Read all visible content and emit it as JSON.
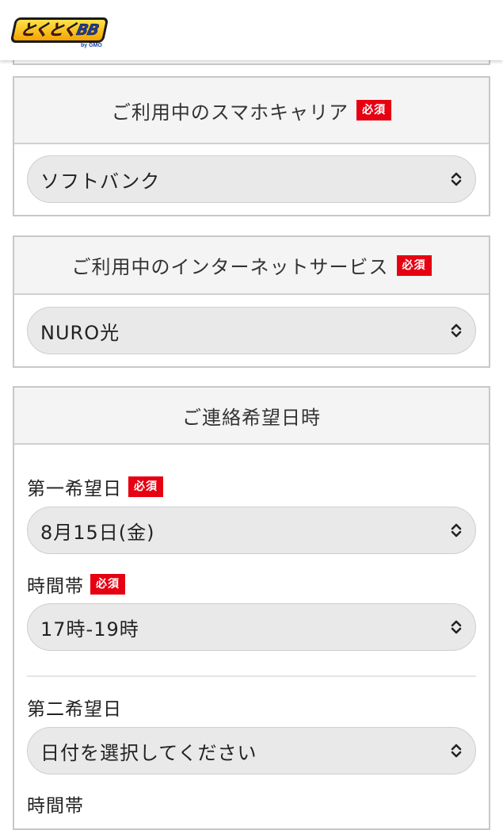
{
  "header": {
    "logo_main_1": "とくとく",
    "logo_main_2": "BB",
    "logo_sub": "by GMO"
  },
  "required_badge": "必須",
  "carrier": {
    "title": "ご利用中のスマホキャリア",
    "selected": "ソフトバンク"
  },
  "internet": {
    "title": "ご利用中のインターネットサービス",
    "selected": "NURO光"
  },
  "contact": {
    "title": "ご連絡希望日時",
    "first_date_label": "第一希望日",
    "first_date_value": "8月15日(金)",
    "first_time_label": "時間帯",
    "first_time_value": "17時-19時",
    "second_date_label": "第二希望日",
    "second_date_value": "日付を選択してください",
    "second_time_label": "時間帯"
  },
  "colors": {
    "required_badge": "#e60012",
    "select_bg": "#e9e9e9",
    "panel_header_bg": "#f4f4f4"
  }
}
